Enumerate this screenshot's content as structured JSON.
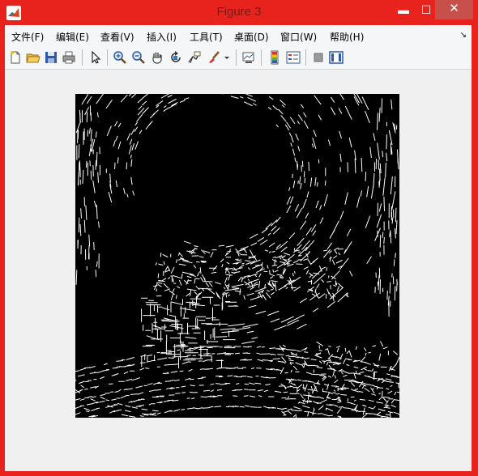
{
  "window": {
    "title": "Figure 3",
    "controls": {
      "minimize": "▬",
      "maximize": "☐",
      "close": "✕"
    }
  },
  "menu": {
    "items": [
      "文件(F)",
      "编辑(E)",
      "查看(V)",
      "插入(I)",
      "工具(T)",
      "桌面(D)",
      "窗口(W)",
      "帮助(H)"
    ],
    "overflow": "↘"
  },
  "toolbar": {
    "buttons": [
      {
        "name": "new-figure-icon"
      },
      {
        "name": "open-file-icon"
      },
      {
        "name": "save-icon"
      },
      {
        "name": "print-icon"
      },
      {
        "name": "edit-plot-arrow-icon"
      },
      {
        "name": "zoom-in-icon"
      },
      {
        "name": "zoom-out-icon"
      },
      {
        "name": "pan-hand-icon"
      },
      {
        "name": "rotate-3d-icon"
      },
      {
        "name": "data-cursor-icon"
      },
      {
        "name": "brush-icon"
      },
      {
        "name": "brush-dropdown-icon"
      },
      {
        "name": "link-plot-icon"
      },
      {
        "name": "insert-colorbar-icon"
      },
      {
        "name": "insert-legend-icon"
      },
      {
        "name": "hide-plot-tools-icon"
      },
      {
        "name": "show-plot-tools-icon"
      }
    ]
  },
  "figure": {
    "content": "binary edge-detection image",
    "colors": {
      "background": "#000000",
      "edges": "#ffffff"
    }
  },
  "colors": {
    "window_frame": "#e8221c",
    "close_button": "#c7504b",
    "client_area": "#f0f0f0"
  }
}
